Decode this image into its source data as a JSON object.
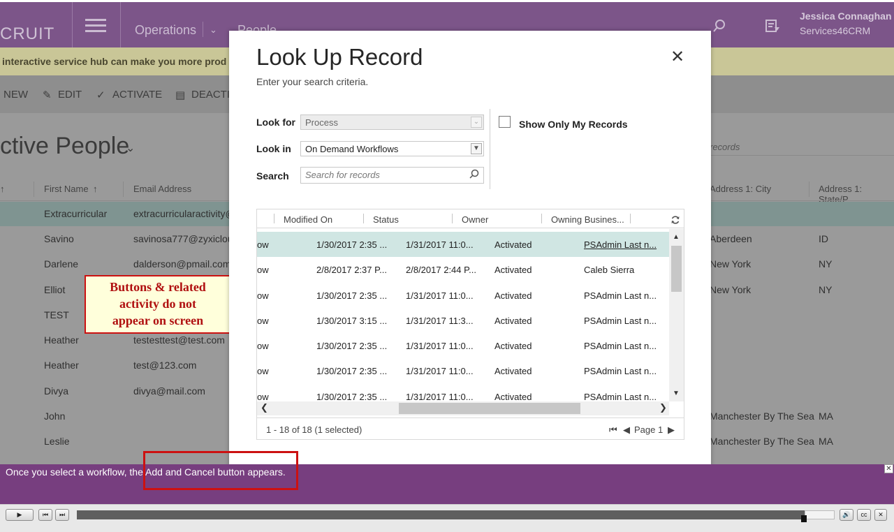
{
  "app": {
    "brand": "CRUIT",
    "nav": [
      "Operations",
      "People"
    ],
    "user_name": "Jessica Connaghan",
    "org_name": "Services46CRM"
  },
  "banner": {
    "text": "interactive service hub can make you more prod"
  },
  "commands": {
    "new": "NEW",
    "edit": "EDIT",
    "activate": "ACTIVATE",
    "deactivate": "DEACTIV"
  },
  "view": {
    "title": "ctive People",
    "search_placeholder": "records",
    "columns": [
      "First Name",
      "Email Address",
      "Address 1: City",
      "Address 1: State/P"
    ],
    "rows": [
      {
        "first": "Extracurricular",
        "email": "extracurricularactivity@",
        "city": "",
        "state": ""
      },
      {
        "first": "Savino",
        "email": "savinosa777@zyxiclou",
        "city": "Aberdeen",
        "state": "ID"
      },
      {
        "first": "Darlene",
        "email": "dalderson@pmail.com",
        "city": "New York",
        "state": "NY"
      },
      {
        "first": "Elliot",
        "email": "",
        "city": "New York",
        "state": "NY"
      },
      {
        "first": "TEST",
        "email": "",
        "city": "",
        "state": ""
      },
      {
        "first": "Heather",
        "email": "testesttest@test.com",
        "city": "",
        "state": ""
      },
      {
        "first": "Heather",
        "email": "test@123.com",
        "city": "",
        "state": ""
      },
      {
        "first": "Divya",
        "email": "divya@mail.com",
        "city": "",
        "state": ""
      },
      {
        "first": "John",
        "email": "",
        "city": "Manchester By The Sea",
        "state": "MA"
      },
      {
        "first": "Leslie",
        "email": "",
        "city": "Manchester By The Sea",
        "state": "MA"
      }
    ]
  },
  "callout": {
    "line1": "Buttons & related",
    "line2": "activity do not",
    "line3": "appear on screen"
  },
  "dialog": {
    "title": "Look Up Record",
    "subtitle": "Enter your search criteria.",
    "look_for_label": "Look for",
    "look_for_value": "Process",
    "look_in_label": "Look in",
    "look_in_value": "On Demand Workflows",
    "search_label": "Search",
    "search_placeholder": "Search for records",
    "show_only_my_records": "Show Only My Records",
    "grid_columns": [
      "Modified On",
      "Status",
      "Owner",
      "Owning Busines..."
    ],
    "grid_rows": [
      {
        "type": "ow",
        "created": "1/30/2017 2:35 ...",
        "modified": "1/31/2017 11:0...",
        "status": "Activated",
        "owner": "PSAdmin Last n..."
      },
      {
        "type": "ow",
        "created": "2/8/2017 2:37 P...",
        "modified": "2/8/2017 2:44 P...",
        "status": "Activated",
        "owner": "Caleb Sierra"
      },
      {
        "type": "ow",
        "created": "1/30/2017 2:35 ...",
        "modified": "1/31/2017 11:0...",
        "status": "Activated",
        "owner": "PSAdmin Last n..."
      },
      {
        "type": "ow",
        "created": "1/30/2017 3:15 ...",
        "modified": "1/31/2017 11:3...",
        "status": "Activated",
        "owner": "PSAdmin Last n..."
      },
      {
        "type": "ow",
        "created": "1/30/2017 2:35 ...",
        "modified": "1/31/2017 11:0...",
        "status": "Activated",
        "owner": "PSAdmin Last n..."
      },
      {
        "type": "ow",
        "created": "1/30/2017 2:35 ...",
        "modified": "1/31/2017 11:0...",
        "status": "Activated",
        "owner": "PSAdmin Last n..."
      },
      {
        "type": "ow",
        "created": "1/30/2017 2:35 ...",
        "modified": "1/31/2017 11:0...",
        "status": "Activated",
        "owner": "PSAdmin Last n..."
      }
    ],
    "record_count": "1 - 18 of 18 (1 selected)",
    "page_label": "Page 1"
  },
  "tip": {
    "text": "Once you select a workflow, the Add and Cancel button appears."
  },
  "player": {
    "cc_label": "cc",
    "progress": 0.956
  }
}
